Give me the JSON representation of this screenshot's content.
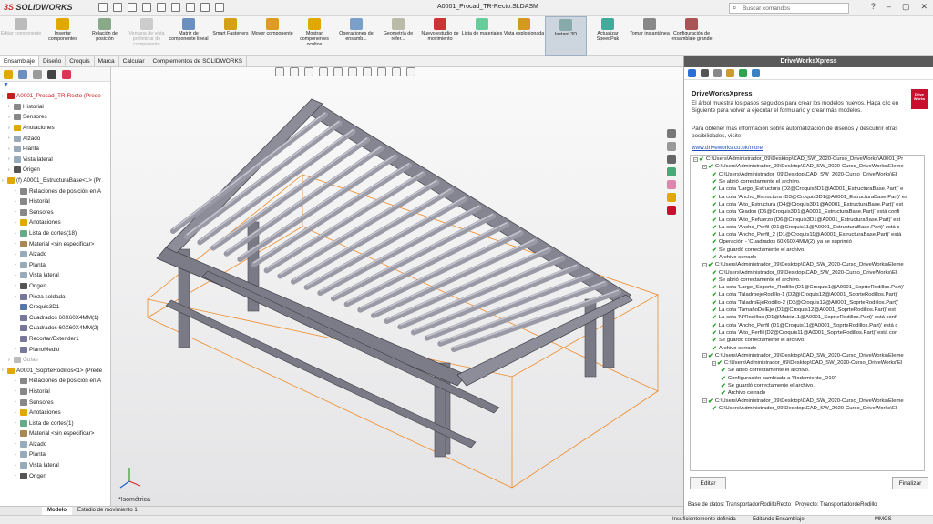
{
  "app": {
    "logo_ds": "3S",
    "logo_text": "SOLIDWORKS",
    "doc_title": "A0001_Procad_TR-Recto.SLDASM",
    "search_placeholder": "Buscar comandos"
  },
  "ribbon": [
    "Editar componente",
    "Insertar componentes",
    "Relación de posición",
    "Ventana de vista preliminar de componente",
    "Matriz de componente lineal",
    "Smart Fasteners",
    "Mover componente",
    "Mostrar componentes ocultos",
    "Operaciones de ensamb...",
    "Geometría de refer...",
    "Nuevo estudio de movimiento",
    "Lista de materiales",
    "Vista explosionada",
    "Instant 3D",
    "Actualizar SpeedPak",
    "Tomar instantánea",
    "Configuración de ensamblaje grande"
  ],
  "tabs": [
    "Ensamblaje",
    "Diseño",
    "Croquis",
    "Marca",
    "Calcular",
    "Complementos de SOLIDWORKS"
  ],
  "tree": [
    {
      "t": "A0001_Procad_TR-Recto  (Prede",
      "lvl": 0,
      "cls": "red",
      "ico": "#c41e1e"
    },
    {
      "t": "Historial",
      "lvl": 1,
      "ico": "#888"
    },
    {
      "t": "Sensores",
      "lvl": 1,
      "ico": "#888"
    },
    {
      "t": "Anotaciones",
      "lvl": 1,
      "ico": "#e0a800"
    },
    {
      "t": "Alzado",
      "lvl": 1,
      "ico": "#9ab"
    },
    {
      "t": "Planta",
      "lvl": 1,
      "ico": "#9ab"
    },
    {
      "t": "Vista lateral",
      "lvl": 1,
      "ico": "#9ab"
    },
    {
      "t": "Origen",
      "lvl": 1,
      "ico": "#555"
    },
    {
      "t": "(f) A0001_EstructuraBase<1> (Pr",
      "lvl": 0,
      "ico": "#e0a800"
    },
    {
      "t": "Relaciones de posición en A",
      "lvl": 2,
      "ico": "#888"
    },
    {
      "t": "Historial",
      "lvl": 2,
      "ico": "#888"
    },
    {
      "t": "Sensores",
      "lvl": 2,
      "ico": "#888"
    },
    {
      "t": "Anotaciones",
      "lvl": 2,
      "ico": "#e0a800"
    },
    {
      "t": "Lista de cortes(18)",
      "lvl": 2,
      "ico": "#6a8"
    },
    {
      "t": "Material <sin especificar>",
      "lvl": 2,
      "ico": "#a85"
    },
    {
      "t": "Alzado",
      "lvl": 2,
      "ico": "#9ab"
    },
    {
      "t": "Planta",
      "lvl": 2,
      "ico": "#9ab"
    },
    {
      "t": "Vista lateral",
      "lvl": 2,
      "ico": "#9ab"
    },
    {
      "t": "Origen",
      "lvl": 2,
      "ico": "#555"
    },
    {
      "t": "Pieza soldada",
      "lvl": 2,
      "ico": "#779"
    },
    {
      "t": "Croquis3D1",
      "lvl": 2,
      "ico": "#57a"
    },
    {
      "t": "Cuadrados 60X60X4MM(1)",
      "lvl": 2,
      "ico": "#779"
    },
    {
      "t": "Cuadrados 60X60X4MM(2)",
      "lvl": 2,
      "ico": "#779"
    },
    {
      "t": "Recortar/Extender1",
      "lvl": 2,
      "ico": "#779"
    },
    {
      "t": "PlanoMedio",
      "lvl": 2,
      "ico": "#779"
    },
    {
      "t": "Guías",
      "lvl": 1,
      "cls": "gray",
      "ico": "#bbb"
    },
    {
      "t": "A0001_SoprteRodillos<1> (Prede",
      "lvl": 0,
      "ico": "#e0a800"
    },
    {
      "t": "Relaciones de posición en A",
      "lvl": 2,
      "ico": "#888"
    },
    {
      "t": "Historial",
      "lvl": 2,
      "ico": "#888"
    },
    {
      "t": "Sensores",
      "lvl": 2,
      "ico": "#888"
    },
    {
      "t": "Anotaciones",
      "lvl": 2,
      "ico": "#e0a800"
    },
    {
      "t": "Lista de cortes(1)",
      "lvl": 2,
      "ico": "#6a8"
    },
    {
      "t": "Material <sin especificar>",
      "lvl": 2,
      "ico": "#a85"
    },
    {
      "t": "Alzado",
      "lvl": 2,
      "ico": "#9ab"
    },
    {
      "t": "Planta",
      "lvl": 2,
      "ico": "#9ab"
    },
    {
      "t": "Vista lateral",
      "lvl": 2,
      "ico": "#9ab"
    },
    {
      "t": "Origen",
      "lvl": 2,
      "ico": "#555"
    }
  ],
  "viewport": {
    "view_label": "*Isométrica"
  },
  "bottom_tabs": [
    "Modelo",
    "Estudio de movimiento 1"
  ],
  "status": {
    "s1": "Insuficientemente definida",
    "s2": "Editando Ensamblaje",
    "s3": "MMGS"
  },
  "panel": {
    "header": "DriveWorksXpress",
    "title": "DriveWorksXpress",
    "badge": "Drive Works",
    "p1": "El árbol muestra los pasos seguidos para crear los modelos nuevos. Haga clic en Siguiente para volver a ejecutar el formulario y crear más modelos.",
    "p2": "Para obtener más información sobre automatización de diseños y descubrir otras posibilidades, visite",
    "link": "www.driveworks.co.uk/more",
    "log": [
      {
        "t": "C:\\Users\\Administrador_09\\Desktop\\CAD_SW_2020-Curso_DriveWorks\\A0001_Pr",
        "l": 0
      },
      {
        "t": "C:\\Users\\Administrador_09\\Desktop\\CAD_SW_2020-Curso_DriveWorks\\Eleme",
        "l": 1
      },
      {
        "t": "C:\\Users\\Administrador_09\\Desktop\\CAD_SW_2020-Curso_DriveWorks\\El",
        "l": 2
      },
      {
        "t": "Se abrió correctamente el archivo.",
        "l": 2
      },
      {
        "t": "La cota 'Largo_Estructura  (D2@Croquis3D1@A0001_EstructuraBase.Part)' e",
        "l": 2
      },
      {
        "t": "La cota 'Ancho_Estructura (D3@Croquis3D1@A0001_EstructuraBase.Part)' es",
        "l": 2
      },
      {
        "t": "La cota 'Alto_Estructura (D4@Croquis3D1@A0001_EstructuraBase.Part)' est",
        "l": 2
      },
      {
        "t": "La cota 'Grados (D5@Croquis3D1@A0001_EstructuraBase.Part)' está confi",
        "l": 2
      },
      {
        "t": "La cota 'Alto_Refuerzo (D6@Croquis3D1@A0001_EstructuraBase.Part)' est",
        "l": 2
      },
      {
        "t": "La cota 'Ancho_Perfil (D1@Croquis11@A0001_EstructuraBase.Part)' está c",
        "l": 2
      },
      {
        "t": "La cota 'Ancho_Perfil_2 (D1@Croquis11@A0001_EstructuraBase.Part)' está",
        "l": 2
      },
      {
        "t": "Operación - 'Cuadrados 60X60X4MM(2)' ya se suprimió",
        "l": 2
      },
      {
        "t": "Se guardó correctamente el archivo.",
        "l": 2
      },
      {
        "t": "Archivo cerrado",
        "l": 2
      },
      {
        "t": "C:\\Users\\Administrador_09\\Desktop\\CAD_SW_2020-Curso_DriveWorks\\Eleme",
        "l": 1
      },
      {
        "t": "C:\\Users\\Administrador_09\\Desktop\\CAD_SW_2020-Curso_DriveWorks\\El",
        "l": 2
      },
      {
        "t": "Se abrió correctamente el archivo.",
        "l": 2
      },
      {
        "t": "La cota 'Largo_Soporte_Rodillo (D1@Croquis1@A0001_SoprteRodillos.Part)'",
        "l": 2
      },
      {
        "t": "La cota 'TaladroejeRodillo-1 (D2@Croquis12@A0001_SoprteRodillos.Part)'",
        "l": 2
      },
      {
        "t": "La cota 'TaladroEjeRodillo-2 (D3@Croquis12@A0001_SoprteRodillos.Part)'",
        "l": 2
      },
      {
        "t": "La cota 'TamañoDelEje (D1@Croquis12@A0001_SoprteRodillos.Part)' est",
        "l": 2
      },
      {
        "t": "La cota 'NºRodillos (D1@MatrizL1@A0001_SoprteRodillos.Part)' está confi",
        "l": 2
      },
      {
        "t": "La cota 'Ancho_Perfil (D1@Croquis11@A0001_SoprteRodillos.Part)' está c",
        "l": 2
      },
      {
        "t": "La cota 'Alto_Perfil (D2@Croquis11@A0001_SoprteRodillos.Part)' está con",
        "l": 2
      },
      {
        "t": "Se guardó correctamente el archivo.",
        "l": 2
      },
      {
        "t": "Archivo cerrado",
        "l": 2
      },
      {
        "t": "C:\\Users\\Administrador_09\\Desktop\\CAD_SW_2020-Curso_DriveWorks\\Eleme",
        "l": 1
      },
      {
        "t": "C:\\Users\\Administrador_09\\Desktop\\CAD_SW_2020-Curso_DriveWorks\\El",
        "l": 2
      },
      {
        "t": "Se abrió correctamente el archivo.",
        "l": 3
      },
      {
        "t": "Configuración cambiada a 'Rodamiento_D10'.",
        "l": 3
      },
      {
        "t": "Se guardó correctamente el archivo.",
        "l": 3
      },
      {
        "t": "Archivo cerrado",
        "l": 3
      },
      {
        "t": "C:\\Users\\Administrador_09\\Desktop\\CAD_SW_2020-Curso_DriveWorks\\Eleme",
        "l": 1
      },
      {
        "t": "C:\\Users\\Administrador_09\\Desktop\\CAD_SW_2020-Curso_DriveWorks\\El",
        "l": 2
      }
    ],
    "edit_btn": "Editar",
    "finish_btn": "Finalizar",
    "db": "Base de datos: TransportadorRodilloRecto",
    "project": "Proyecto: TransportadordeRodillo"
  }
}
